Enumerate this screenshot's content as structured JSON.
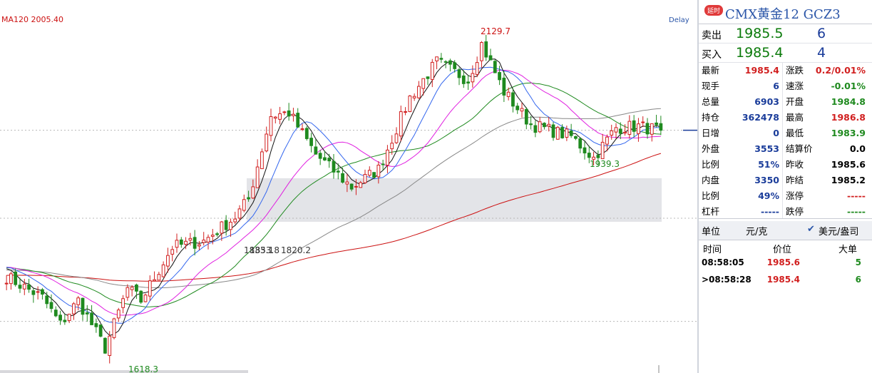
{
  "chart_data": {
    "type": "candlestick",
    "indicator_label": "MA120 2005.40",
    "delay_label": "Delay",
    "annotations": [
      {
        "text": "2129.7",
        "type": "high"
      },
      {
        "text": "1939.3",
        "type": "low"
      },
      {
        "text": "1618.3",
        "type": "low"
      },
      {
        "text": "1833.1",
        "type": "label"
      },
      {
        "text": "1853.8",
        "type": "label"
      },
      {
        "text": "1820.2",
        "type": "label"
      }
    ],
    "ylim": [
      1600,
      2150
    ],
    "price_line": 1985.4,
    "anchors": [
      [
        0,
        1740
      ],
      [
        8,
        1705
      ],
      [
        12,
        1660
      ],
      [
        16,
        1700
      ],
      [
        22,
        1620
      ],
      [
        27,
        1720
      ],
      [
        30,
        1700
      ],
      [
        37,
        1790
      ],
      [
        44,
        1800
      ],
      [
        51,
        1840
      ],
      [
        54,
        1870
      ],
      [
        59,
        2010
      ],
      [
        63,
        2015
      ],
      [
        69,
        1945
      ],
      [
        77,
        1890
      ],
      [
        83,
        1920
      ],
      [
        90,
        2040
      ],
      [
        96,
        2100
      ],
      [
        103,
        2070
      ],
      [
        106,
        2130
      ],
      [
        111,
        2050
      ],
      [
        117,
        1995
      ],
      [
        126,
        1975
      ],
      [
        131,
        1939
      ],
      [
        136,
        1990
      ],
      [
        141,
        1992
      ],
      [
        146,
        1985.4
      ]
    ],
    "colors": {
      "up": "#d11f1f",
      "down": "#1f8a1f",
      "ma5": "#111111",
      "ma10": "#3366ee",
      "ma20": "#e020e0",
      "ma30": "#1f8a1f",
      "ma60": "#888888",
      "ma120": "#cc1111"
    }
  },
  "panel": {
    "badge": "延时",
    "title": "CMX黄金12  GCZ3",
    "sell": {
      "label": "卖出",
      "price": "1985.5",
      "vol": "6"
    },
    "buy": {
      "label": "买入",
      "price": "1985.4",
      "vol": "4"
    },
    "left": [
      {
        "label": "最新",
        "value": "1985.4",
        "color": "#d11f1f"
      },
      {
        "label": "现手",
        "value": "6",
        "color": "#1a3c9a"
      },
      {
        "label": "总量",
        "value": "6903",
        "color": "#1a3c9a"
      },
      {
        "label": "持仓",
        "value": "362478",
        "color": "#1a3c9a"
      },
      {
        "label": "日增",
        "value": "0",
        "color": "#1a3c9a"
      },
      {
        "label": "外盘",
        "value": "3553",
        "color": "#1a3c9a"
      },
      {
        "label": "比例",
        "value": "51%",
        "color": "#1a3c9a"
      },
      {
        "label": "内盘",
        "value": "3350",
        "color": "#1a3c9a"
      },
      {
        "label": "比例",
        "value": "49%",
        "color": "#1a3c9a"
      },
      {
        "label": "杠杆",
        "value": "-----",
        "color": "#1a3c9a"
      }
    ],
    "right": [
      {
        "label": "涨跌",
        "value": "0.2/0.01%",
        "color": "#d11f1f"
      },
      {
        "label": "速涨",
        "value": "-0.01%",
        "color": "#1f8a1f"
      },
      {
        "label": "开盘",
        "value": "1984.8",
        "color": "#1f8a1f"
      },
      {
        "label": "最高",
        "value": "1986.8",
        "color": "#d11f1f"
      },
      {
        "label": "最低",
        "value": "1983.9",
        "color": "#1f8a1f"
      },
      {
        "label": "结算价",
        "value": "0.0",
        "color": "#000000"
      },
      {
        "label": "昨收",
        "value": "1985.6",
        "color": "#000000"
      },
      {
        "label": "昨结",
        "value": "1985.2",
        "color": "#000000"
      },
      {
        "label": "涨停",
        "value": "-----",
        "color": "#d11f1f"
      },
      {
        "label": "跌停",
        "value": "-----",
        "color": "#1f8a1f"
      }
    ],
    "unit_label": "单位",
    "unit_value": "元/克",
    "currency": "美元/盎司",
    "trades_header": {
      "time": "时间",
      "price": "价位",
      "size": "大单"
    },
    "trades": [
      {
        "time": "08:58:05",
        "price": "1985.6",
        "size": "5"
      },
      {
        "time": ">08:58:28",
        "price": "1985.4",
        "size": "6"
      }
    ]
  }
}
